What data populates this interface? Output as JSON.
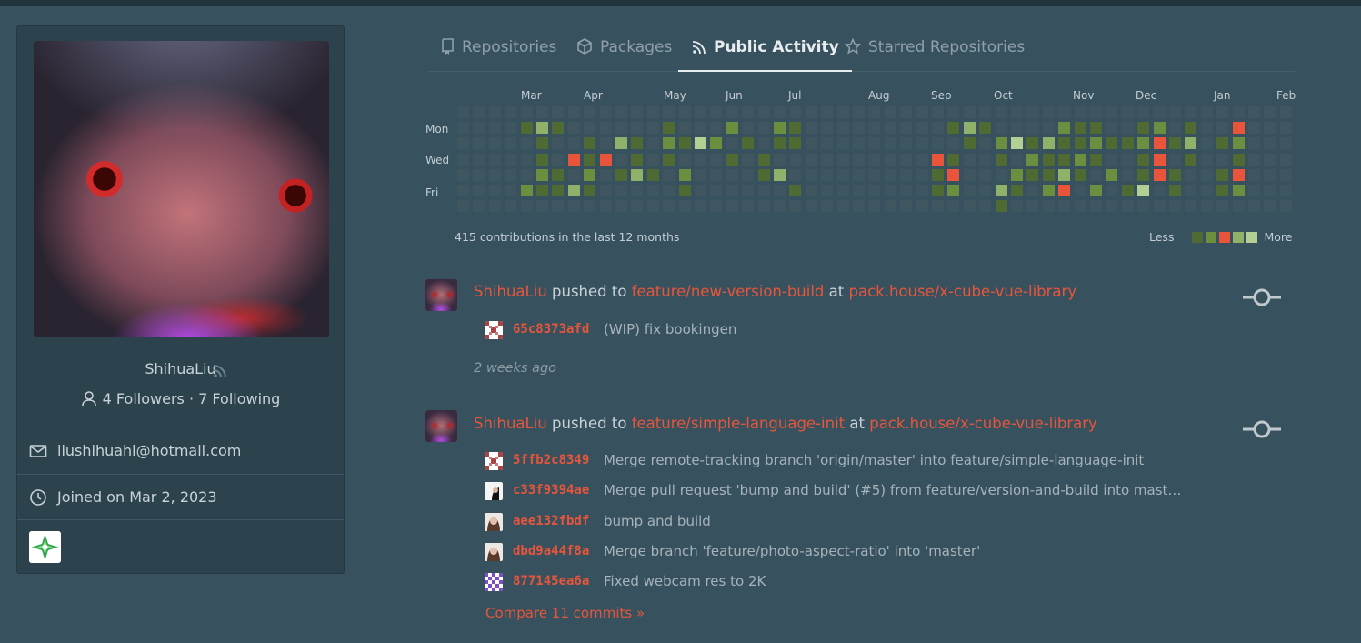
{
  "profile": {
    "username": "ShihuaLiu",
    "followers_text": "4 Followers · 7 Following",
    "email": "liushihuahl@hotmail.com",
    "joined": "Joined on Mar 2, 2023"
  },
  "tabs": [
    "Repositories",
    "Packages",
    "Public Activity",
    "Starred Repositories"
  ],
  "active_tab": "Public Activity",
  "heatmap": {
    "months": [
      "Mar",
      "Apr",
      "May",
      "Jun",
      "Jul",
      "Aug",
      "Sep",
      "Oct",
      "Nov",
      "Dec",
      "Jan",
      "Feb"
    ],
    "day_labels": [
      "Mon",
      "Wed",
      "Fri"
    ],
    "summary": "415 contributions in the last 12 months",
    "legend_less": "Less",
    "legend_more": "More",
    "colors": {
      "empty": "#3f5560",
      "level1": "#4f6b33",
      "level2": "#6b8f3e",
      "level3": "#e8553b",
      "level4": "#8fb16a",
      "level5": "#b4cf93"
    }
  },
  "feed": [
    {
      "user": "ShihuaLiu",
      "action": "pushed to",
      "branch": "feature/new-version-build",
      "at": "at",
      "repo": "pack.house/x-cube-vue-library",
      "commits": [
        {
          "sha": "65c8373afd",
          "message": "(WIP) fix bookingen"
        }
      ],
      "time": "2 weeks ago"
    },
    {
      "user": "ShihuaLiu",
      "action": "pushed to",
      "branch": "feature/simple-language-init",
      "at": "at",
      "repo": "pack.house/x-cube-vue-library",
      "commits": [
        {
          "sha": "5ffb2c8349",
          "message": "Merge remote-tracking branch 'origin/master' into feature/simple-language-init"
        },
        {
          "sha": "c33f9394ae",
          "message": "Merge pull request 'bump and build' (#5) from feature/version-and-build into mast…"
        },
        {
          "sha": "aee132fbdf",
          "message": "bump and build"
        },
        {
          "sha": "dbd9a44f8a",
          "message": "Merge branch 'feature/photo-aspect-ratio' into 'master'"
        },
        {
          "sha": "877145ea6a",
          "message": "Fixed webcam res to 2K"
        }
      ],
      "compare": "Compare 11 commits »"
    }
  ]
}
